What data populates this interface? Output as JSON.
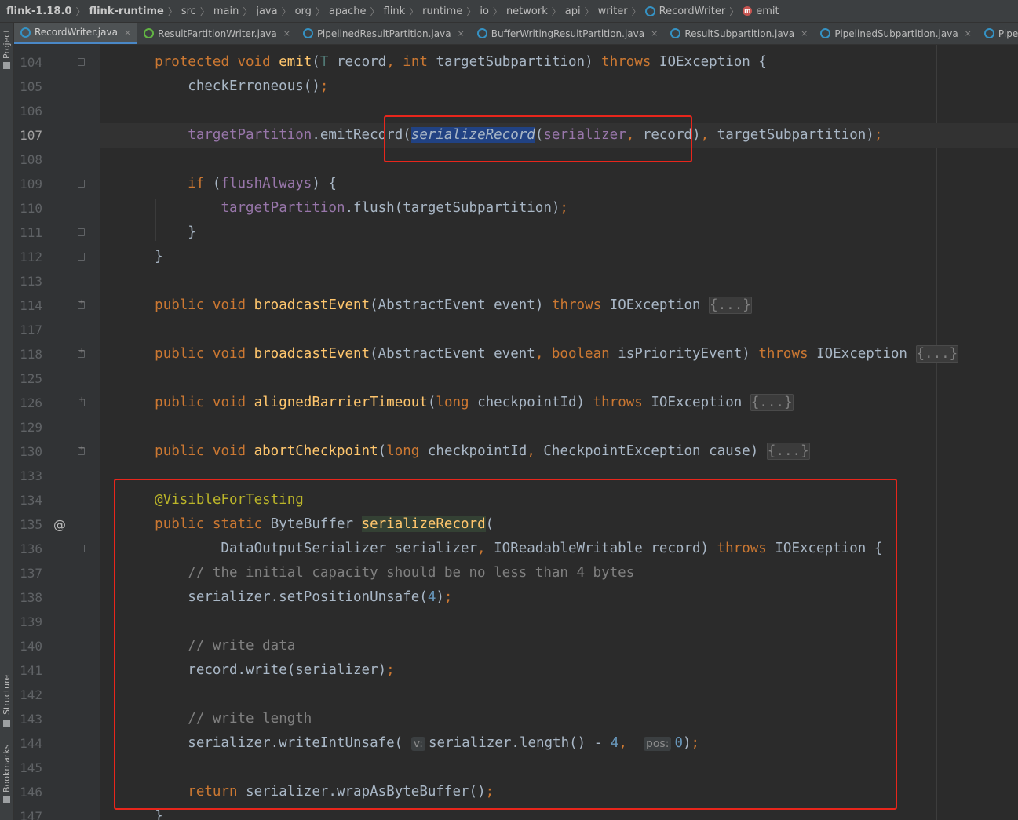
{
  "breadcrumb": [
    {
      "label": "flink-1.18.0",
      "bold": true
    },
    {
      "label": "flink-runtime",
      "bold": true
    },
    {
      "label": "src"
    },
    {
      "label": "main"
    },
    {
      "label": "java"
    },
    {
      "label": "org"
    },
    {
      "label": "apache"
    },
    {
      "label": "flink"
    },
    {
      "label": "runtime"
    },
    {
      "label": "io"
    },
    {
      "label": "network"
    },
    {
      "label": "api"
    },
    {
      "label": "writer"
    },
    {
      "label": "RecordWriter",
      "icon": "c"
    },
    {
      "label": "emit",
      "icon": "m"
    }
  ],
  "left_tools": {
    "project": "Project",
    "structure": "Structure",
    "bookmarks": "Bookmarks"
  },
  "tabs": [
    {
      "label": "RecordWriter.java",
      "icon": "c",
      "active": true
    },
    {
      "label": "ResultPartitionWriter.java",
      "icon": "i"
    },
    {
      "label": "PipelinedResultPartition.java",
      "icon": "c"
    },
    {
      "label": "BufferWritingResultPartition.java",
      "icon": "c"
    },
    {
      "label": "ResultSubpartition.java",
      "icon": "c"
    },
    {
      "label": "PipelinedSubpartition.java",
      "icon": "c"
    },
    {
      "label": "PipelinedSubpartitionView",
      "icon": "c"
    }
  ],
  "close_glyph": "×",
  "code_lines": [
    {
      "n": "104",
      "fold": "open",
      "html": "    <span class=\"kw\">protected void </span><span class=\"fn\">emit</span>(<span class=\"tp\">T</span> record<span class=\"kw\">, int </span>targetSubpartition) <span class=\"kw\">throws </span>IOException {"
    },
    {
      "n": "105",
      "html": "        checkErroneous()<span class=\"kw\">;</span>"
    },
    {
      "n": "106",
      "html": ""
    },
    {
      "n": "107",
      "current": true,
      "html": "        <span class=\"fld\">targetPartition</span>.emitRecord(<span class=\"sel\">serializeRecord</span>(<span class=\"fld\">serializer</span><span class=\"kw\">, </span>record)<span class=\"kw\">, </span>targetSubpartition)<span class=\"kw\">;</span>"
    },
    {
      "n": "108",
      "html": ""
    },
    {
      "n": "109",
      "fold": "open",
      "html": "        <span class=\"kw\">if </span>(<span class=\"fld\">flushAlways</span>) {"
    },
    {
      "n": "110",
      "html": "            <span class=\"fld\">targetPartition</span>.flush(targetSubpartition)<span class=\"kw\">;</span>"
    },
    {
      "n": "111",
      "fold": "open",
      "html": "        }"
    },
    {
      "n": "112",
      "fold": "open",
      "html": "    }"
    },
    {
      "n": "113",
      "html": ""
    },
    {
      "n": "114",
      "fold": "plus",
      "html": "    <span class=\"kw\">public void </span><span class=\"fn\">broadcastEvent</span>(AbstractEvent event) <span class=\"kw\">throws </span>IOException <span class=\"fb\">{...}</span>"
    },
    {
      "n": "117",
      "html": ""
    },
    {
      "n": "118",
      "fold": "plus",
      "html": "    <span class=\"kw\">public void </span><span class=\"fn\">broadcastEvent</span>(AbstractEvent event<span class=\"kw\">, boolean </span>isPriorityEvent) <span class=\"kw\">throws </span>IOException <span class=\"fb\">{...}</span>"
    },
    {
      "n": "125",
      "html": ""
    },
    {
      "n": "126",
      "fold": "plus",
      "html": "    <span class=\"kw\">public void </span><span class=\"fn\">alignedBarrierTimeout</span>(<span class=\"kw\">long </span>checkpointId) <span class=\"kw\">throws </span>IOException <span class=\"fb\">{...}</span>"
    },
    {
      "n": "129",
      "html": ""
    },
    {
      "n": "130",
      "fold": "plus",
      "html": "    <span class=\"kw\">public void </span><span class=\"fn\">abortCheckpoint</span>(<span class=\"kw\">long </span>checkpointId<span class=\"kw\">, </span>CheckpointException cause) <span class=\"fb\">{...}</span>"
    },
    {
      "n": "133",
      "html": ""
    },
    {
      "n": "134",
      "html": "    <span class=\"an\">@VisibleForTesting</span>"
    },
    {
      "n": "135",
      "mark": "@",
      "html": "    <span class=\"kw\">public static </span>ByteBuffer <span class=\"hl\">serializeRecord</span>("
    },
    {
      "n": "136",
      "fold": "open",
      "html": "            DataOutputSerializer serializer<span class=\"kw\">, </span>IOReadableWritable record) <span class=\"kw\">throws </span>IOException {"
    },
    {
      "n": "137",
      "html": "        <span class=\"cm\">// the initial capacity should be no less than 4 bytes</span>"
    },
    {
      "n": "138",
      "html": "        serializer.setPositionUnsafe(<span class=\"num\">4</span>)<span class=\"kw\">;</span>"
    },
    {
      "n": "139",
      "html": ""
    },
    {
      "n": "140",
      "html": "        <span class=\"cm\">// write data</span>"
    },
    {
      "n": "141",
      "html": "        record.write(serializer)<span class=\"kw\">;</span>"
    },
    {
      "n": "142",
      "html": ""
    },
    {
      "n": "143",
      "html": "        <span class=\"cm\">// write length</span>"
    },
    {
      "n": "144",
      "html": "        serializer.writeIntUnsafe( <span class=\"hint\">v:</span>serializer.length() - <span class=\"num\">4</span><span class=\"kw\">, </span> <span class=\"hint\">pos:</span><span class=\"num\">0</span>)<span class=\"kw\">;</span>"
    },
    {
      "n": "145",
      "html": ""
    },
    {
      "n": "146",
      "html": "        <span class=\"kw\">return </span>serializer.wrapAsByteBuffer()<span class=\"kw\">;</span>"
    },
    {
      "n": "147",
      "html": "    }"
    }
  ]
}
